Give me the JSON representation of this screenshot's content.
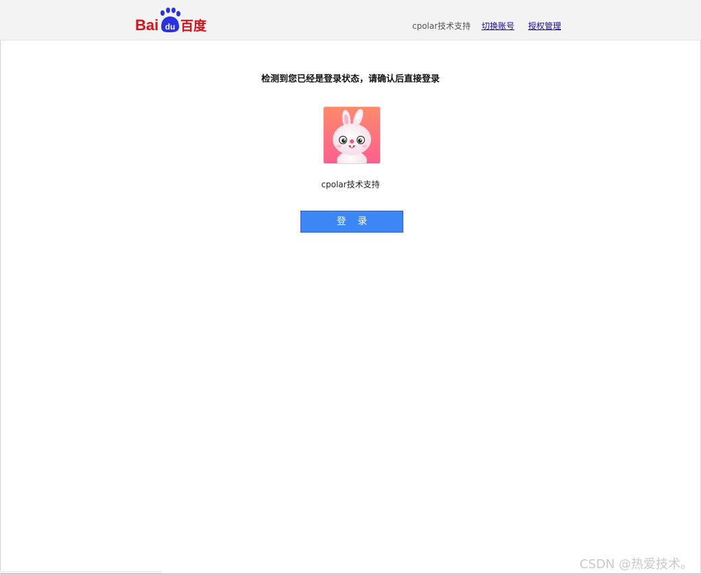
{
  "header": {
    "logo_text_latin": "Bai",
    "logo_text_du": "du",
    "logo_text_cn": "百度",
    "user_name": "cpolar技术支持",
    "switch_account": "切换账号",
    "auth_manage": "授权管理"
  },
  "main": {
    "prompt": "检测到您已经是登录状态，请确认后直接登录",
    "user_name": "cpolar技术支持",
    "login_button": "登 录"
  },
  "watermark": "CSDN @热爱技术。",
  "colors": {
    "brand_red": "#de0f17",
    "brand_blue": "#2932e1",
    "button_blue": "#3c86f5",
    "link_blue": "#1a0dab"
  },
  "icons": {
    "logo": "baidu-paw-logo",
    "avatar": "pink-bunny-avatar"
  }
}
